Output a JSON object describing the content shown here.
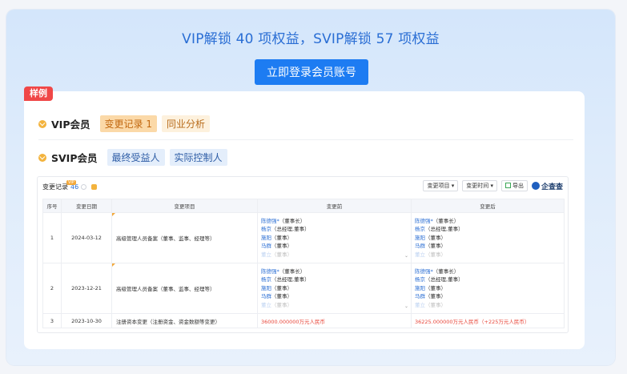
{
  "headline": "VIP解锁 40 项权益，SVIP解锁 57 项权益",
  "login_button": "立即登录会员账号",
  "sample_tag": "样例",
  "vip": {
    "tier": "VIP会员",
    "chips": [
      "变更记录 1",
      "同业分析"
    ]
  },
  "svip": {
    "tier": "SVIP会员",
    "chips": [
      "最终受益人",
      "实际控制人"
    ]
  },
  "preview": {
    "title": "变更记录",
    "count": "46",
    "vip_badge": "VIP",
    "filter_item": "变更项目 ▾",
    "filter_time": "变更时间 ▾",
    "export": "导出",
    "brand": "企查查",
    "columns": [
      "序号",
      "变更日期",
      "变更项目",
      "变更前",
      "变更后"
    ],
    "rows": [
      {
        "no": "1",
        "date": "2024-03-12",
        "item": "高级管理人员备案（董事、监事、经理等）",
        "before": [
          {
            "name": "陈德强*",
            "role": "（董事长）"
          },
          {
            "name": "杨京",
            "role": "（总经理,董事）"
          },
          {
            "name": "施阳",
            "role": "（董事）"
          },
          {
            "name": "马群",
            "role": "（董事）"
          },
          {
            "name": "董立",
            "role": "（董事）"
          }
        ],
        "after": [
          {
            "name": "陈德强*",
            "role": "（董事长）"
          },
          {
            "name": "杨京",
            "role": "（总经理,董事）"
          },
          {
            "name": "施阳",
            "role": "（董事）"
          },
          {
            "name": "马群",
            "role": "（董事）"
          },
          {
            "name": "董立",
            "role": "（董事）"
          }
        ]
      },
      {
        "no": "2",
        "date": "2023-12-21",
        "item": "高级管理人员备案（董事、监事、经理等）",
        "before": [
          {
            "name": "陈德强*",
            "role": "（董事长）"
          },
          {
            "name": "杨京",
            "role": "（总经理,董事）"
          },
          {
            "name": "施阳",
            "role": "（董事）"
          },
          {
            "name": "马群",
            "role": "（董事）"
          },
          {
            "name": "董立",
            "role": "（董事）"
          }
        ],
        "after": [
          {
            "name": "陈德强*",
            "role": "（董事长）"
          },
          {
            "name": "杨京",
            "role": "（总经理,董事）"
          },
          {
            "name": "施阳",
            "role": "（董事）"
          },
          {
            "name": "马群",
            "role": "（董事）"
          },
          {
            "name": "董立",
            "role": "（董事）"
          }
        ]
      },
      {
        "no": "3",
        "date": "2023-10-30",
        "item": "注册资本变更（注册资金、资金数额等变更）",
        "before_text": "36000.000000万元人民币",
        "after_text": "36225.000000万元人民币（+225万元人民币）"
      }
    ]
  },
  "colors": {
    "accent": "#1d7cf2",
    "headline": "#2a6ed4",
    "sample_tag": "#f04747",
    "increase_red": "#e8463a"
  }
}
